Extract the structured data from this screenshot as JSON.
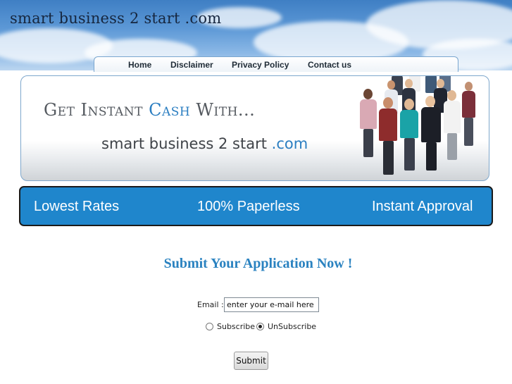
{
  "header": {
    "site_title": "smart business 2 start .com"
  },
  "nav": {
    "items": [
      {
        "label": "Home"
      },
      {
        "label": "Disclaimer"
      },
      {
        "label": "Privacy Policy"
      },
      {
        "label": "Contact us"
      }
    ]
  },
  "banner": {
    "headline_part1": "Get Instant ",
    "headline_accent": "Cash",
    "headline_part2": " With...",
    "brand_part1": "smart business 2 start ",
    "brand_accent": ".com"
  },
  "features": {
    "items": [
      {
        "label": "Lowest Rates"
      },
      {
        "label": "100% Paperless"
      },
      {
        "label": "Instant Approval"
      }
    ]
  },
  "form": {
    "heading": "Submit Your Application Now !",
    "email_label": "Email :",
    "email_value": "enter your e-mail here",
    "subscribe_label": "Subscribe",
    "unsubscribe_label": "UnSubscribe",
    "selected_option": "UnSubscribe",
    "submit_label": "Submit"
  },
  "colors": {
    "accent_blue": "#2b7ec1",
    "feature_bar": "#1f86cc"
  }
}
